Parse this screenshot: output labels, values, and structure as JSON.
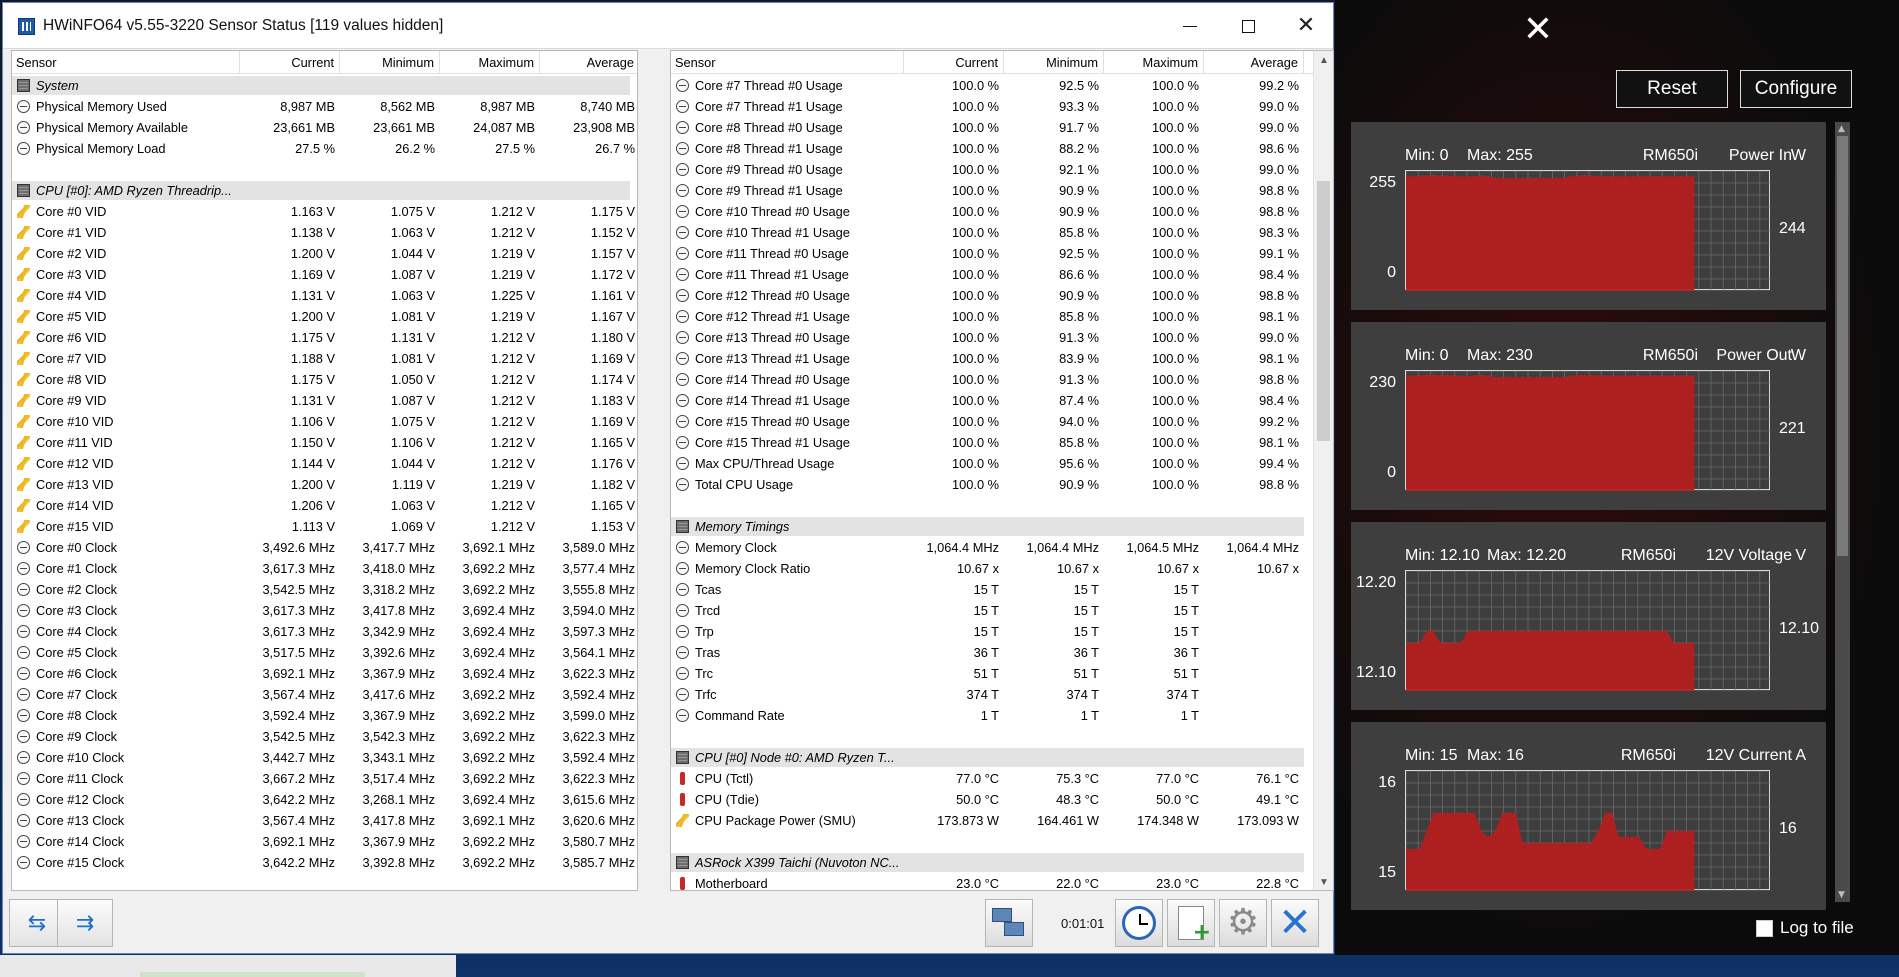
{
  "window": {
    "title": "HWiNFO64 v5.55-3220 Sensor Status [119 values hidden]"
  },
  "columns": {
    "sensor": "Sensor",
    "current": "Current",
    "minimum": "Minimum",
    "maximum": "Maximum",
    "average": "Average"
  },
  "left_rows": [
    {
      "t": "section",
      "icon": "chip",
      "name": "System"
    },
    {
      "icon": "clock",
      "name": "Physical Memory Used",
      "c": "8,987 MB",
      "mn": "8,562 MB",
      "mx": "8,987 MB",
      "av": "8,740 MB"
    },
    {
      "icon": "clock",
      "name": "Physical Memory Available",
      "c": "23,661 MB",
      "mn": "23,661 MB",
      "mx": "24,087 MB",
      "av": "23,908 MB"
    },
    {
      "icon": "clock",
      "name": "Physical Memory Load",
      "c": "27.5 %",
      "mn": "26.2 %",
      "mx": "27.5 %",
      "av": "26.7 %"
    },
    {
      "t": "blank"
    },
    {
      "t": "section",
      "icon": "chip",
      "name": "CPU [#0]: AMD Ryzen Threadrip..."
    },
    {
      "icon": "volt",
      "name": "Core #0 VID",
      "c": "1.163 V",
      "mn": "1.075 V",
      "mx": "1.212 V",
      "av": "1.175 V"
    },
    {
      "icon": "volt",
      "name": "Core #1 VID",
      "c": "1.138 V",
      "mn": "1.063 V",
      "mx": "1.212 V",
      "av": "1.152 V"
    },
    {
      "icon": "volt",
      "name": "Core #2 VID",
      "c": "1.200 V",
      "mn": "1.044 V",
      "mx": "1.219 V",
      "av": "1.157 V"
    },
    {
      "icon": "volt",
      "name": "Core #3 VID",
      "c": "1.169 V",
      "mn": "1.087 V",
      "mx": "1.219 V",
      "av": "1.172 V"
    },
    {
      "icon": "volt",
      "name": "Core #4 VID",
      "c": "1.131 V",
      "mn": "1.063 V",
      "mx": "1.225 V",
      "av": "1.161 V"
    },
    {
      "icon": "volt",
      "name": "Core #5 VID",
      "c": "1.200 V",
      "mn": "1.081 V",
      "mx": "1.219 V",
      "av": "1.167 V"
    },
    {
      "icon": "volt",
      "name": "Core #6 VID",
      "c": "1.175 V",
      "mn": "1.131 V",
      "mx": "1.212 V",
      "av": "1.180 V"
    },
    {
      "icon": "volt",
      "name": "Core #7 VID",
      "c": "1.188 V",
      "mn": "1.081 V",
      "mx": "1.212 V",
      "av": "1.169 V"
    },
    {
      "icon": "volt",
      "name": "Core #8 VID",
      "c": "1.175 V",
      "mn": "1.050 V",
      "mx": "1.212 V",
      "av": "1.174 V"
    },
    {
      "icon": "volt",
      "name": "Core #9 VID",
      "c": "1.131 V",
      "mn": "1.087 V",
      "mx": "1.212 V",
      "av": "1.183 V"
    },
    {
      "icon": "volt",
      "name": "Core #10 VID",
      "c": "1.106 V",
      "mn": "1.075 V",
      "mx": "1.212 V",
      "av": "1.169 V"
    },
    {
      "icon": "volt",
      "name": "Core #11 VID",
      "c": "1.150 V",
      "mn": "1.106 V",
      "mx": "1.212 V",
      "av": "1.165 V"
    },
    {
      "icon": "volt",
      "name": "Core #12 VID",
      "c": "1.144 V",
      "mn": "1.044 V",
      "mx": "1.212 V",
      "av": "1.176 V"
    },
    {
      "icon": "volt",
      "name": "Core #13 VID",
      "c": "1.200 V",
      "mn": "1.119 V",
      "mx": "1.219 V",
      "av": "1.182 V"
    },
    {
      "icon": "volt",
      "name": "Core #14 VID",
      "c": "1.206 V",
      "mn": "1.063 V",
      "mx": "1.212 V",
      "av": "1.165 V"
    },
    {
      "icon": "volt",
      "name": "Core #15 VID",
      "c": "1.113 V",
      "mn": "1.069 V",
      "mx": "1.212 V",
      "av": "1.153 V"
    },
    {
      "icon": "clock",
      "name": "Core #0 Clock",
      "c": "3,492.6 MHz",
      "mn": "3,417.7 MHz",
      "mx": "3,692.1 MHz",
      "av": "3,589.0 MHz"
    },
    {
      "icon": "clock",
      "name": "Core #1 Clock",
      "c": "3,617.3 MHz",
      "mn": "3,418.0 MHz",
      "mx": "3,692.2 MHz",
      "av": "3,577.4 MHz"
    },
    {
      "icon": "clock",
      "name": "Core #2 Clock",
      "c": "3,542.5 MHz",
      "mn": "3,318.2 MHz",
      "mx": "3,692.2 MHz",
      "av": "3,555.8 MHz"
    },
    {
      "icon": "clock",
      "name": "Core #3 Clock",
      "c": "3,617.3 MHz",
      "mn": "3,417.8 MHz",
      "mx": "3,692.4 MHz",
      "av": "3,594.0 MHz"
    },
    {
      "icon": "clock",
      "name": "Core #4 Clock",
      "c": "3,617.3 MHz",
      "mn": "3,342.9 MHz",
      "mx": "3,692.4 MHz",
      "av": "3,597.3 MHz"
    },
    {
      "icon": "clock",
      "name": "Core #5 Clock",
      "c": "3,517.5 MHz",
      "mn": "3,392.6 MHz",
      "mx": "3,692.4 MHz",
      "av": "3,564.1 MHz"
    },
    {
      "icon": "clock",
      "name": "Core #6 Clock",
      "c": "3,692.1 MHz",
      "mn": "3,367.9 MHz",
      "mx": "3,692.4 MHz",
      "av": "3,622.3 MHz"
    },
    {
      "icon": "clock",
      "name": "Core #7 Clock",
      "c": "3,567.4 MHz",
      "mn": "3,417.6 MHz",
      "mx": "3,692.2 MHz",
      "av": "3,592.4 MHz"
    },
    {
      "icon": "clock",
      "name": "Core #8 Clock",
      "c": "3,592.4 MHz",
      "mn": "3,367.9 MHz",
      "mx": "3,692.2 MHz",
      "av": "3,599.0 MHz"
    },
    {
      "icon": "clock",
      "name": "Core #9 Clock",
      "c": "3,542.5 MHz",
      "mn": "3,542.3 MHz",
      "mx": "3,692.2 MHz",
      "av": "3,622.3 MHz"
    },
    {
      "icon": "clock",
      "name": "Core #10 Clock",
      "c": "3,442.7 MHz",
      "mn": "3,343.1 MHz",
      "mx": "3,692.2 MHz",
      "av": "3,592.4 MHz"
    },
    {
      "icon": "clock",
      "name": "Core #11 Clock",
      "c": "3,667.2 MHz",
      "mn": "3,517.4 MHz",
      "mx": "3,692.2 MHz",
      "av": "3,622.3 MHz"
    },
    {
      "icon": "clock",
      "name": "Core #12 Clock",
      "c": "3,642.2 MHz",
      "mn": "3,268.1 MHz",
      "mx": "3,692.4 MHz",
      "av": "3,615.6 MHz"
    },
    {
      "icon": "clock",
      "name": "Core #13 Clock",
      "c": "3,567.4 MHz",
      "mn": "3,417.8 MHz",
      "mx": "3,692.1 MHz",
      "av": "3,620.6 MHz"
    },
    {
      "icon": "clock",
      "name": "Core #14 Clock",
      "c": "3,692.1 MHz",
      "mn": "3,367.9 MHz",
      "mx": "3,692.2 MHz",
      "av": "3,580.7 MHz"
    },
    {
      "icon": "clock",
      "name": "Core #15 Clock",
      "c": "3,642.2 MHz",
      "mn": "3,392.8 MHz",
      "mx": "3,692.2 MHz",
      "av": "3,585.7 MHz"
    }
  ],
  "right_rows": [
    {
      "icon": "clock",
      "name": "Core #7 Thread #0 Usage",
      "c": "100.0 %",
      "mn": "92.5 %",
      "mx": "100.0 %",
      "av": "99.2 %"
    },
    {
      "icon": "clock",
      "name": "Core #7 Thread #1 Usage",
      "c": "100.0 %",
      "mn": "93.3 %",
      "mx": "100.0 %",
      "av": "99.0 %"
    },
    {
      "icon": "clock",
      "name": "Core #8 Thread #0 Usage",
      "c": "100.0 %",
      "mn": "91.7 %",
      "mx": "100.0 %",
      "av": "99.0 %"
    },
    {
      "icon": "clock",
      "name": "Core #8 Thread #1 Usage",
      "c": "100.0 %",
      "mn": "88.2 %",
      "mx": "100.0 %",
      "av": "98.6 %"
    },
    {
      "icon": "clock",
      "name": "Core #9 Thread #0 Usage",
      "c": "100.0 %",
      "mn": "92.1 %",
      "mx": "100.0 %",
      "av": "99.0 %"
    },
    {
      "icon": "clock",
      "name": "Core #9 Thread #1 Usage",
      "c": "100.0 %",
      "mn": "90.9 %",
      "mx": "100.0 %",
      "av": "98.8 %"
    },
    {
      "icon": "clock",
      "name": "Core #10 Thread #0 Usage",
      "c": "100.0 %",
      "mn": "90.9 %",
      "mx": "100.0 %",
      "av": "98.8 %"
    },
    {
      "icon": "clock",
      "name": "Core #10 Thread #1 Usage",
      "c": "100.0 %",
      "mn": "85.8 %",
      "mx": "100.0 %",
      "av": "98.3 %"
    },
    {
      "icon": "clock",
      "name": "Core #11 Thread #0 Usage",
      "c": "100.0 %",
      "mn": "92.5 %",
      "mx": "100.0 %",
      "av": "99.1 %"
    },
    {
      "icon": "clock",
      "name": "Core #11 Thread #1 Usage",
      "c": "100.0 %",
      "mn": "86.6 %",
      "mx": "100.0 %",
      "av": "98.4 %"
    },
    {
      "icon": "clock",
      "name": "Core #12 Thread #0 Usage",
      "c": "100.0 %",
      "mn": "90.9 %",
      "mx": "100.0 %",
      "av": "98.8 %"
    },
    {
      "icon": "clock",
      "name": "Core #12 Thread #1 Usage",
      "c": "100.0 %",
      "mn": "85.8 %",
      "mx": "100.0 %",
      "av": "98.1 %"
    },
    {
      "icon": "clock",
      "name": "Core #13 Thread #0 Usage",
      "c": "100.0 %",
      "mn": "91.3 %",
      "mx": "100.0 %",
      "av": "99.0 %"
    },
    {
      "icon": "clock",
      "name": "Core #13 Thread #1 Usage",
      "c": "100.0 %",
      "mn": "83.9 %",
      "mx": "100.0 %",
      "av": "98.1 %"
    },
    {
      "icon": "clock",
      "name": "Core #14 Thread #0 Usage",
      "c": "100.0 %",
      "mn": "91.3 %",
      "mx": "100.0 %",
      "av": "98.8 %"
    },
    {
      "icon": "clock",
      "name": "Core #14 Thread #1 Usage",
      "c": "100.0 %",
      "mn": "87.4 %",
      "mx": "100.0 %",
      "av": "98.4 %"
    },
    {
      "icon": "clock",
      "name": "Core #15 Thread #0 Usage",
      "c": "100.0 %",
      "mn": "94.0 %",
      "mx": "100.0 %",
      "av": "99.2 %"
    },
    {
      "icon": "clock",
      "name": "Core #15 Thread #1 Usage",
      "c": "100.0 %",
      "mn": "85.8 %",
      "mx": "100.0 %",
      "av": "98.1 %"
    },
    {
      "icon": "clock",
      "name": "Max CPU/Thread Usage",
      "c": "100.0 %",
      "mn": "95.6 %",
      "mx": "100.0 %",
      "av": "99.4 %"
    },
    {
      "icon": "clock",
      "name": "Total CPU Usage",
      "c": "100.0 %",
      "mn": "90.9 %",
      "mx": "100.0 %",
      "av": "98.8 %"
    },
    {
      "t": "blank"
    },
    {
      "t": "section",
      "icon": "chip",
      "name": "Memory Timings"
    },
    {
      "icon": "clock",
      "name": "Memory Clock",
      "c": "1,064.4 MHz",
      "mn": "1,064.4 MHz",
      "mx": "1,064.5 MHz",
      "av": "1,064.4 MHz"
    },
    {
      "icon": "clock",
      "name": "Memory Clock Ratio",
      "c": "10.67 x",
      "mn": "10.67 x",
      "mx": "10.67 x",
      "av": "10.67 x"
    },
    {
      "icon": "clock",
      "name": "Tcas",
      "c": "15 T",
      "mn": "15 T",
      "mx": "15 T",
      "av": ""
    },
    {
      "icon": "clock",
      "name": "Trcd",
      "c": "15 T",
      "mn": "15 T",
      "mx": "15 T",
      "av": ""
    },
    {
      "icon": "clock",
      "name": "Trp",
      "c": "15 T",
      "mn": "15 T",
      "mx": "15 T",
      "av": ""
    },
    {
      "icon": "clock",
      "name": "Tras",
      "c": "36 T",
      "mn": "36 T",
      "mx": "36 T",
      "av": ""
    },
    {
      "icon": "clock",
      "name": "Trc",
      "c": "51 T",
      "mn": "51 T",
      "mx": "51 T",
      "av": ""
    },
    {
      "icon": "clock",
      "name": "Trfc",
      "c": "374 T",
      "mn": "374 T",
      "mx": "374 T",
      "av": ""
    },
    {
      "icon": "clock",
      "name": "Command Rate",
      "c": "1 T",
      "mn": "1 T",
      "mx": "1 T",
      "av": ""
    },
    {
      "t": "blank"
    },
    {
      "t": "section",
      "icon": "chip",
      "name": "CPU [#0] Node #0: AMD Ryzen T..."
    },
    {
      "icon": "therm",
      "name": "CPU (Tctl)",
      "c": "77.0 °C",
      "mn": "75.3 °C",
      "mx": "77.0 °C",
      "av": "76.1 °C"
    },
    {
      "icon": "therm",
      "name": "CPU (Tdie)",
      "c": "50.0 °C",
      "mn": "48.3 °C",
      "mx": "50.0 °C",
      "av": "49.1 °C"
    },
    {
      "icon": "volt",
      "name": "CPU Package Power (SMU)",
      "c": "173.873 W",
      "mn": "164.461 W",
      "mx": "174.348 W",
      "av": "173.093 W"
    },
    {
      "t": "blank"
    },
    {
      "t": "section",
      "icon": "chip",
      "name": "ASRock X399 Taichi (Nuvoton NC..."
    },
    {
      "icon": "therm",
      "name": "Motherboard",
      "c": "23.0 °C",
      "mn": "22.0 °C",
      "mx": "23.0 °C",
      "av": "22.8 °C"
    }
  ],
  "toolbar": {
    "timer": "0:01:01"
  },
  "panel": {
    "reset": "Reset",
    "configure": "Configure",
    "log_to_file": "Log to file",
    "close": "✕"
  },
  "graphs": [
    {
      "min_label": "Min: 0",
      "max_label": "Max: 255",
      "device": "RM650i",
      "sensor": "Power In",
      "unit": "W",
      "top": "255",
      "bottom": "0",
      "current": "244",
      "ymin": 0,
      "ymax": 255,
      "values": [
        244,
        244,
        245,
        245,
        246,
        245,
        245,
        244,
        244,
        243,
        244,
        245,
        244,
        240,
        240,
        240,
        240,
        240,
        240,
        240,
        240,
        240,
        240,
        240,
        244,
        245,
        246,
        245,
        244,
        244,
        244,
        244,
        244,
        244,
        244,
        244,
        244,
        244,
        244,
        244,
        244,
        244,
        244
      ]
    },
    {
      "min_label": "Min: 0",
      "max_label": "Max: 230",
      "device": "RM650i",
      "sensor": "Power Out",
      "unit": "W",
      "top": "230",
      "bottom": "0",
      "current": "221",
      "ymin": 0,
      "ymax": 230,
      "values": [
        221,
        221,
        222,
        222,
        223,
        222,
        222,
        221,
        221,
        220,
        221,
        222,
        221,
        218,
        218,
        218,
        218,
        218,
        218,
        218,
        218,
        218,
        218,
        218,
        221,
        222,
        222,
        222,
        221,
        221,
        221,
        221,
        221,
        221,
        221,
        221,
        221,
        221,
        221,
        221,
        221,
        221,
        221
      ]
    },
    {
      "min_label": "Min: 12.10",
      "max_label": "Max: 12.20",
      "device": "RM650i",
      "sensor": "12V Voltage",
      "unit": "V",
      "top": "12.20",
      "bottom": "12.10",
      "current": "12.10",
      "ymin": 12.1,
      "ymax": 12.2,
      "values": [
        12.14,
        12.14,
        12.14,
        12.15,
        12.15,
        12.14,
        12.14,
        12.14,
        12.14,
        12.15,
        12.15,
        12.15,
        12.15,
        12.15,
        12.15,
        12.15,
        12.15,
        12.15,
        12.15,
        12.15,
        12.15,
        12.15,
        12.15,
        12.15,
        12.15,
        12.15,
        12.15,
        12.15,
        12.15,
        12.15,
        12.15,
        12.15,
        12.15,
        12.15,
        12.15,
        12.15,
        12.15,
        12.15,
        12.15,
        12.14,
        12.14,
        12.14,
        12.14
      ]
    },
    {
      "min_label": "Min: 15",
      "max_label": "Max: 16",
      "device": "RM650i",
      "sensor": "12V Current",
      "unit": "A",
      "top": "16",
      "bottom": "15",
      "current": "16",
      "ymin": 15,
      "ymax": 16,
      "values": [
        15.35,
        15.35,
        15.35,
        15.5,
        15.65,
        15.65,
        15.65,
        15.65,
        15.65,
        15.65,
        15.65,
        15.5,
        15.45,
        15.5,
        15.65,
        15.65,
        15.65,
        15.4,
        15.4,
        15.4,
        15.4,
        15.4,
        15.4,
        15.4,
        15.4,
        15.4,
        15.4,
        15.4,
        15.5,
        15.65,
        15.65,
        15.45,
        15.45,
        15.45,
        15.45,
        15.35,
        15.35,
        15.35,
        15.5,
        15.5,
        15.5,
        15.5,
        15.5
      ]
    }
  ],
  "colors": {
    "graph_fill": "#b71c1c",
    "panel_bg": "#3e3e3e",
    "accent_blue": "#2a72cf"
  }
}
